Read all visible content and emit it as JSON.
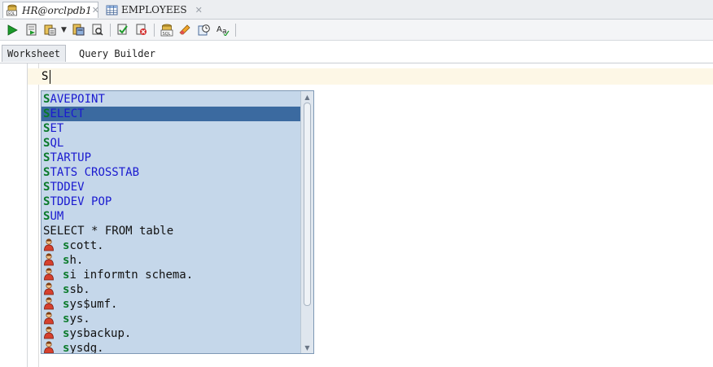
{
  "tabs": [
    {
      "label": "HR@orclpdb1",
      "icon": "sql-connection-icon",
      "close": "✕"
    },
    {
      "label": "EMPLOYEES",
      "icon": "table-grid-icon",
      "close": "✕"
    }
  ],
  "toolbar": {
    "buttons": [
      "run-statement-icon",
      "run-script-icon",
      "explain-plan-icon",
      "autotrace-icon",
      "sql-tuning-icon",
      "commit-icon",
      "rollback-icon",
      "unshared-sql-icon",
      "clear-eraser-icon",
      "sql-history-icon",
      "format-case-icon"
    ]
  },
  "subtabs": {
    "worksheet": "Worksheet",
    "query_builder": "Query Builder"
  },
  "editor": {
    "text": "S"
  },
  "completion": {
    "typed_prefix": "S",
    "selected_index": 1,
    "items": [
      {
        "kind": "keyword",
        "prefix": "S",
        "rest": "AVEPOINT"
      },
      {
        "kind": "keyword",
        "prefix": "S",
        "rest": "ELECT"
      },
      {
        "kind": "keyword",
        "prefix": "S",
        "rest": "ET"
      },
      {
        "kind": "keyword",
        "prefix": "S",
        "rest": "QL"
      },
      {
        "kind": "keyword",
        "prefix": "S",
        "rest": "TARTUP"
      },
      {
        "kind": "keyword",
        "prefix": "S",
        "rest": "TATS CROSSTAB"
      },
      {
        "kind": "keyword",
        "prefix": "S",
        "rest": "TDDEV"
      },
      {
        "kind": "keyword",
        "prefix": "S",
        "rest": "TDDEV POP"
      },
      {
        "kind": "keyword",
        "prefix": "S",
        "rest": "UM"
      },
      {
        "kind": "snippet",
        "prefix": "",
        "rest": "SELECT * FROM table"
      },
      {
        "kind": "schema",
        "prefix": "s",
        "rest": "cott."
      },
      {
        "kind": "schema",
        "prefix": "s",
        "rest": "h."
      },
      {
        "kind": "schema",
        "prefix": "s",
        "rest": "i informtn schema."
      },
      {
        "kind": "schema",
        "prefix": "s",
        "rest": "sb."
      },
      {
        "kind": "schema",
        "prefix": "s",
        "rest": "ys$umf."
      },
      {
        "kind": "schema",
        "prefix": "s",
        "rest": "ys."
      },
      {
        "kind": "schema",
        "prefix": "s",
        "rest": "ysbackup."
      },
      {
        "kind": "schema",
        "prefix": "s",
        "rest": "ysdg."
      }
    ],
    "scroll_position": 0.0,
    "visible_fraction": 0.85
  },
  "colors": {
    "popup_bg": "#c5d7ea",
    "selection": "#3b6aa0",
    "keyword": "#1a1ad0",
    "match_highlight": "#0a7a2a",
    "current_line": "#fdf7e6"
  }
}
